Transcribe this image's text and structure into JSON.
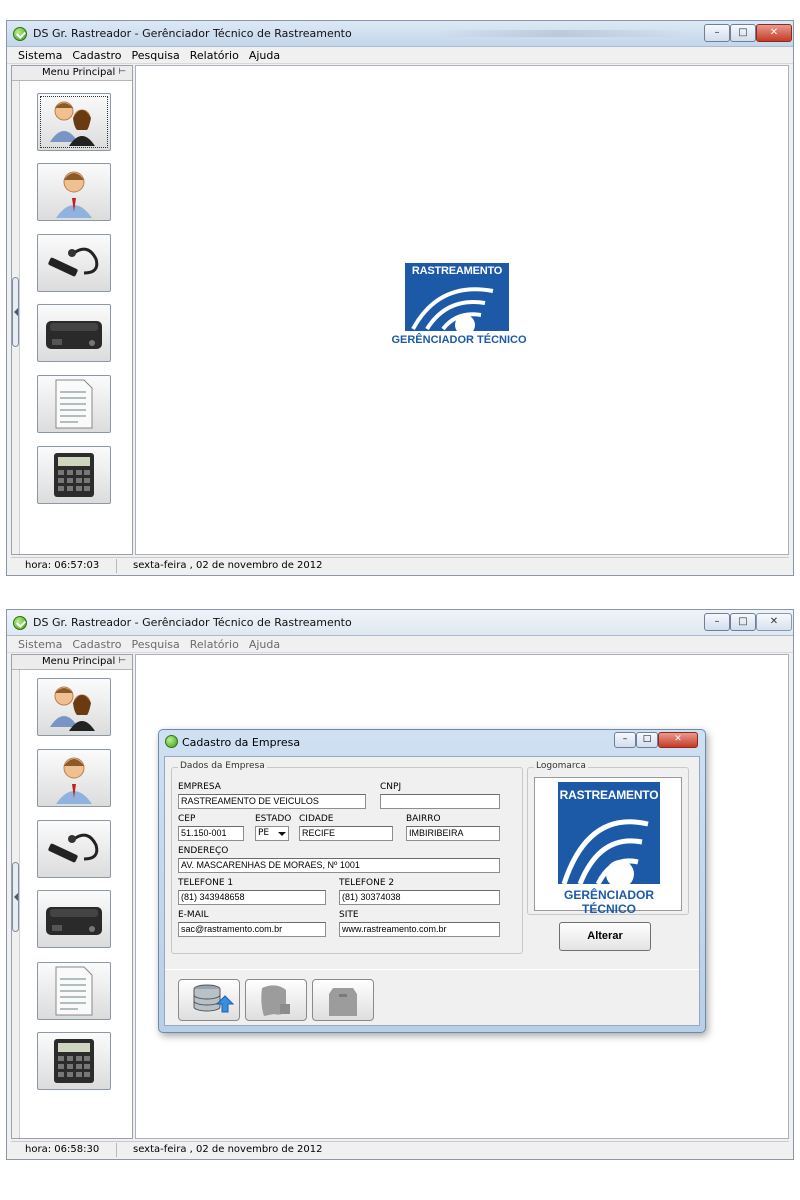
{
  "app": {
    "window_title": "DS Gr. Rastreador - Gerênciador Técnico de Rastreamento",
    "menu": [
      "Sistema",
      "Cadastro",
      "Pesquisa",
      "Relatório",
      "Ajuda"
    ],
    "sidebar_title": "Menu Principal",
    "sidebar_buttons": [
      {
        "icon": "users-icon"
      },
      {
        "icon": "user-icon"
      },
      {
        "icon": "tracker-cable-icon"
      },
      {
        "icon": "tracker-device-icon"
      },
      {
        "icon": "report-document-icon"
      },
      {
        "icon": "calculator-icon"
      }
    ],
    "logo": {
      "top_text": "RASTREAMENTO",
      "bottom_text": "GERÊNCIADOR TÉCNICO",
      "color": "#1c5aa8"
    }
  },
  "screen1": {
    "status_hora_label": "hora:",
    "status_hora": "06:57:03",
    "status_date": "sexta-feira , 02 de novembro de 2012"
  },
  "screen2": {
    "status_hora_label": "hora:",
    "status_hora": "06:58:30",
    "status_date": "sexta-feira , 02 de novembro de 2012",
    "dialog": {
      "title": "Cadastro da Empresa",
      "group_dados": "Dados da Empresa",
      "group_logo": "Logomarca",
      "fields": {
        "empresa": {
          "label": "EMPRESA",
          "value": "RASTREAMENTO DE VEICULOS"
        },
        "cnpj": {
          "label": "CNPJ",
          "value": ""
        },
        "cep": {
          "label": "CEP",
          "value": "51.150-001"
        },
        "estado": {
          "label": "ESTADO",
          "value": "PE"
        },
        "cidade": {
          "label": "CIDADE",
          "value": "RECIFE"
        },
        "bairro": {
          "label": "BAIRRO",
          "value": "IMBIRIBEIRA"
        },
        "endereco": {
          "label": "ENDEREÇO",
          "value": "AV. MASCARENHAS DE MORAES, Nº 1001"
        },
        "telefone1": {
          "label": "TELEFONE 1",
          "value": "(81) 343948658"
        },
        "telefone2": {
          "label": "TELEFONE 2",
          "value": "(81) 30374038"
        },
        "email": {
          "label": "E-MAIL",
          "value": "sac@rastramento.com.br"
        },
        "site": {
          "label": "SITE",
          "value": "www.rastreamento.com.br"
        }
      },
      "alterar_label": "Alterar",
      "toolbar": [
        {
          "icon": "database-save-icon",
          "enabled": true
        },
        {
          "icon": "edit-disabled-icon",
          "enabled": false
        },
        {
          "icon": "delete-disabled-icon",
          "enabled": false
        }
      ]
    }
  }
}
